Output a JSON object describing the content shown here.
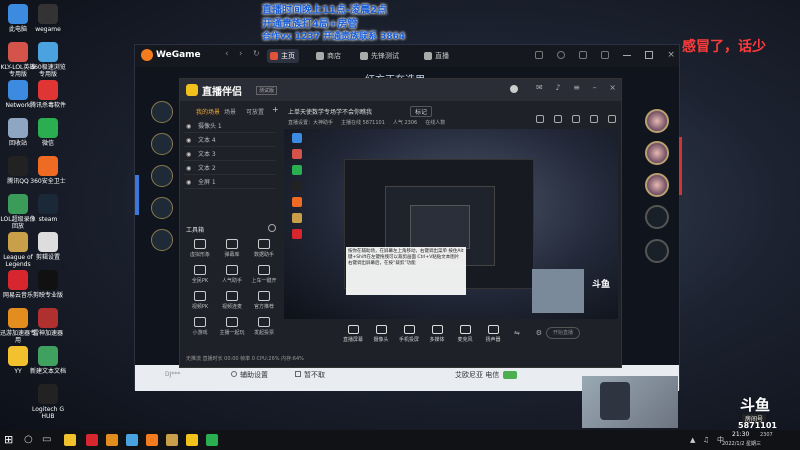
{
  "overlay": {
    "line1": "直播时间晚上11点-凌晨2点",
    "line2": "开通贵族打4局+房管",
    "line3": "合作vx 1237   开通贵族联系 3864",
    "right_text": "感冒了，话少"
  },
  "desktop_icons": [
    {
      "label": "此电脑",
      "color": "#3c8be0"
    },
    {
      "label": "KLY-LOL英雄专用版",
      "color": "#d4534a"
    },
    {
      "label": "Network",
      "color": "#3c8be0"
    },
    {
      "label": "回收站",
      "color": "#8fa6c2"
    },
    {
      "label": "腾讯QQ",
      "color": "#222222"
    },
    {
      "label": "LOL超级录像回放",
      "color": "#3b9c5a"
    },
    {
      "label": "League of Legends",
      "color": "#c9a049"
    },
    {
      "label": "网易云音乐",
      "color": "#d8262e"
    },
    {
      "label": "迅游加速器专用",
      "color": "#e28d1e"
    },
    {
      "label": "YY",
      "color": "#f2c12e"
    }
  ],
  "desktop_icons_col2": [
    {
      "label": "wegame",
      "color": "#333333"
    },
    {
      "label": "360极速浏览专用版",
      "color": "#4aa3df"
    },
    {
      "label": "腾讯杀毒软件",
      "color": "#e03535"
    },
    {
      "label": "微信",
      "color": "#2bae4f"
    },
    {
      "label": "360安全卫士",
      "color": "#ef6b24"
    },
    {
      "label": "steam",
      "color": "#1b2838"
    },
    {
      "label": "剪辑设置",
      "color": "#dddddd"
    },
    {
      "label": "剪映专业版",
      "color": "#111111"
    },
    {
      "label": "雷神加速器",
      "color": "#b03030"
    },
    {
      "label": "新建文本文档",
      "color": "#40a060"
    },
    {
      "label": "Logitech G HUB",
      "color": "#222222"
    }
  ],
  "wegame": {
    "brand": "WeGame",
    "tabs": [
      "主页",
      "商店",
      "先锋测试",
      "直播"
    ],
    "subtitle": "红方正在选用",
    "bottom_left": "DJ***",
    "bottom_btn1": "辅助设置",
    "bottom_btn2": "暂不取",
    "bottom_status": "艾欧尼亚 电信"
  },
  "obs": {
    "brand": "直播伴侣",
    "version": "测试版",
    "panel_tabs": [
      "我的场景",
      "场景",
      "可放置"
    ],
    "scenes": [
      "摄像头 1",
      "文本 4",
      "文本 3",
      "文本 2",
      "全屏 1"
    ],
    "tools_title": "工具箱",
    "tools": [
      "虚拟形象",
      "弹幕库",
      "数据助手",
      "全民PK",
      "人气助手",
      "上车一键开",
      "视频PK",
      "视频连麦",
      "官方推荐",
      "小游戏",
      "主播一起玩",
      "发起投票"
    ],
    "stream_title": "上单天使数学专场学不会你瞧我",
    "stream_btn": "标记",
    "status_items": [
      "直播设置：大神助手",
      "主播在线 5871101",
      "人气 2306",
      "在线人数"
    ],
    "bottom_tools": [
      "直播屏幕",
      "摄像头",
      "手机投屏",
      "多媒体",
      "麦克风",
      "扬声器"
    ],
    "start_btn": "开始直播",
    "footer": "无推流   直播时长 00:00   帧率 0  CPU:26%   内存:64%",
    "notice": "按你在辅助场，在屏幕左上角移动，右键调出菜单 按住Alt键+Shift在左键拖拽可以裁剪画面 Ctrl+V粘贴文本图片 右键调出屏幕后，在按“裁剪”功能"
  },
  "brand_badge": {
    "logo": "斗鱼",
    "room_label": "房间号",
    "room_number": "5871101",
    "counter": "2307"
  },
  "taskbar": {
    "time": "21:30",
    "date": "2022/1/2 星期三"
  }
}
